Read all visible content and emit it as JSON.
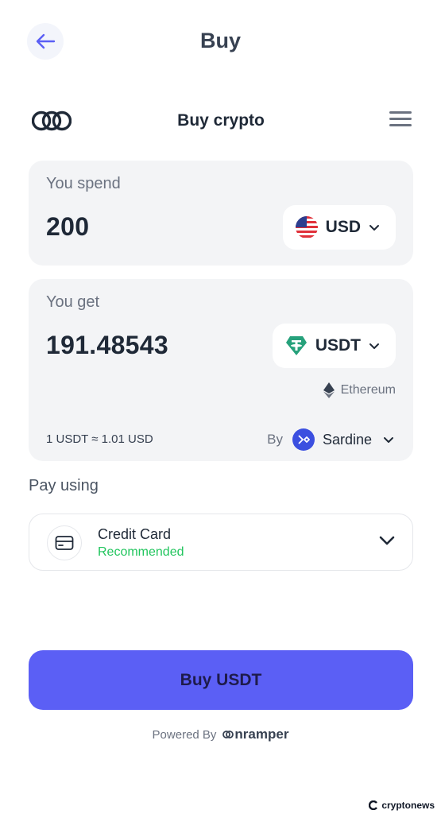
{
  "header": {
    "title": "Buy"
  },
  "widget": {
    "title": "Buy crypto"
  },
  "spend": {
    "label": "You spend",
    "amount": "200",
    "currency": "USD",
    "currency_icon": "us-flag-icon"
  },
  "get": {
    "label": "You get",
    "amount": "191.48543",
    "currency": "USDT",
    "currency_icon": "tether-icon",
    "network": "Ethereum",
    "rate": "1 USDT ≈ 1.01 USD",
    "provider_prefix": "By",
    "provider": "Sardine"
  },
  "pay": {
    "label": "Pay using",
    "method": "Credit Card",
    "tag": "Recommended"
  },
  "cta": {
    "label": "Buy USDT"
  },
  "footer": {
    "powered_by": "Powered By",
    "brand": "nramper"
  },
  "watermark": {
    "text": "cryptonews"
  },
  "colors": {
    "accent": "#5b5ff5",
    "tether": "#26a17b",
    "recommended": "#22c55e",
    "sardine": "#3b4fe0"
  }
}
